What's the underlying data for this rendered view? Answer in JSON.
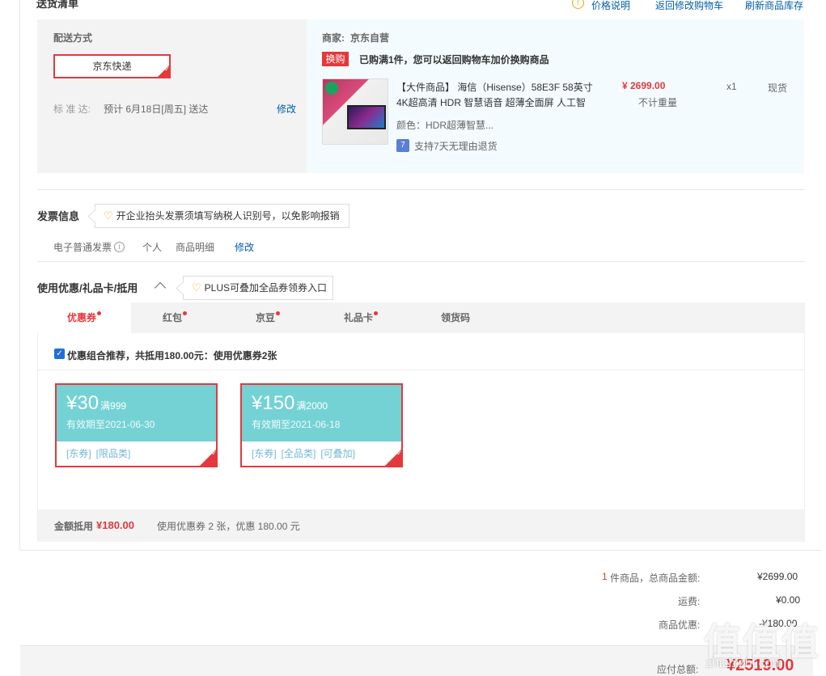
{
  "header": {
    "title": "送货清单",
    "price_note": "价格说明",
    "back_cart": "返回修改购物车",
    "refresh_stock": "刷新商品库存"
  },
  "delivery": {
    "label": "配送方式",
    "method": "京东快递",
    "standard_label": "标 准 达:",
    "standard_value": "预计 6月18日[周五] 送达",
    "modify": "修改"
  },
  "merchant": {
    "label": "商家:",
    "name": "京东自营",
    "tag": "换购",
    "promo": "已购满1件，您可以返回购物车加价换购商品"
  },
  "product": {
    "title_line1": "【大件商品】 海信（Hisense）58E3F 58英寸",
    "title_line2": "4K超高清 HDR 智慧语音 超薄全面屏 人工智",
    "color": "颜色：HDR超薄智慧...",
    "return_icon": "7",
    "return_policy": "支持7天无理由退货",
    "price": "¥ 2699.00",
    "weight": "不计重量",
    "qty": "x1",
    "stock": "现货"
  },
  "invoice": {
    "title": "发票信息",
    "tip": "开企业抬头发票须填写纳税人识别号，以免影响报销",
    "type": "电子普通发票",
    "info_icon": "i",
    "owner": "个人",
    "content": "商品明细",
    "modify": "修改"
  },
  "discount": {
    "title": "使用优惠/礼品卡/抵用",
    "caret": "^",
    "tip": "PLUS可叠加全品券领券入口",
    "tabs": [
      "优惠券",
      "红包",
      "京豆",
      "礼品卡",
      "领货码"
    ],
    "combo_text": "优惠组合推荐，共抵用180.00元：使用优惠券2张",
    "coupons": [
      {
        "amount": "¥30",
        "condition": "满999",
        "expiry": "有效期至2021-06-30",
        "tags": [
          "[东券]",
          "[限品类]"
        ]
      },
      {
        "amount": "¥150",
        "condition": "满2000",
        "expiry": "有效期至2021-06-18",
        "tags": [
          "[东券]",
          "[全品类]",
          "[可叠加]"
        ]
      }
    ],
    "footer_label": "金额抵用",
    "footer_amount": "¥180.00",
    "footer_desc": "使用优惠券 2 张，优惠 180.00 元"
  },
  "summary": {
    "count": "1",
    "count_suffix": "件商品，总商品金额:",
    "total_goods": "¥2699.00",
    "shipping_label": "运费:",
    "shipping": "¥0.00",
    "discount_label": "商品优惠:",
    "discount": "-¥180.00",
    "payable_label": "应付总额:",
    "payable": "¥2519.00"
  },
  "watermark": {
    "text": "值值值",
    "url": "zhizhizhi.com"
  },
  "colors": {
    "accent_red": "#e4393c",
    "link_blue": "#005ea7",
    "coupon_teal": "#74d2d4"
  }
}
